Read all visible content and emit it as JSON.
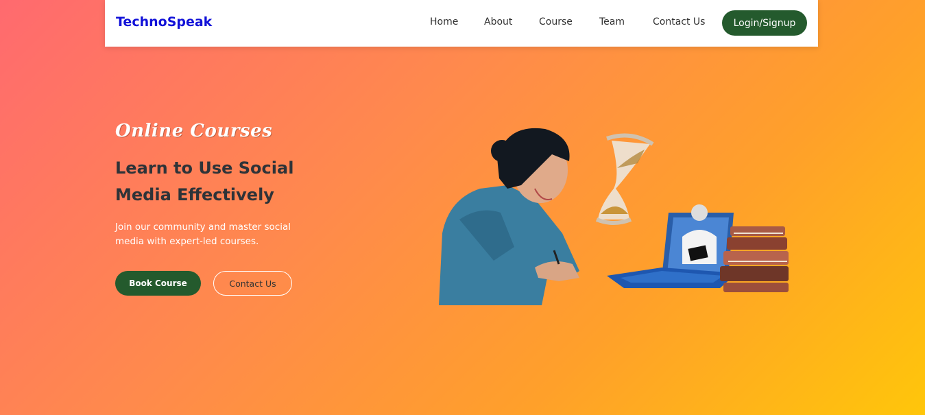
{
  "nav": {
    "brand": "TechnoSpeak",
    "links": [
      "Home",
      "About",
      "Course",
      "Team",
      "Contact Us"
    ],
    "login_label": "Login/Signup"
  },
  "hero": {
    "tagline": "Online Courses",
    "title": "Learn to Use Social Media Effectively",
    "description": "Join our community and master social media with expert-led courses.",
    "primary_button": "Book Course",
    "secondary_button": "Contact Us"
  },
  "colors": {
    "brand": "#1010d8",
    "button_dark_green": "#245a2d",
    "gradient_start": "#ff6a6f",
    "gradient_end": "#ffc60a"
  },
  "icons": [
    "student-illustration",
    "hourglass-icon",
    "laptop-icon",
    "books-icon"
  ]
}
